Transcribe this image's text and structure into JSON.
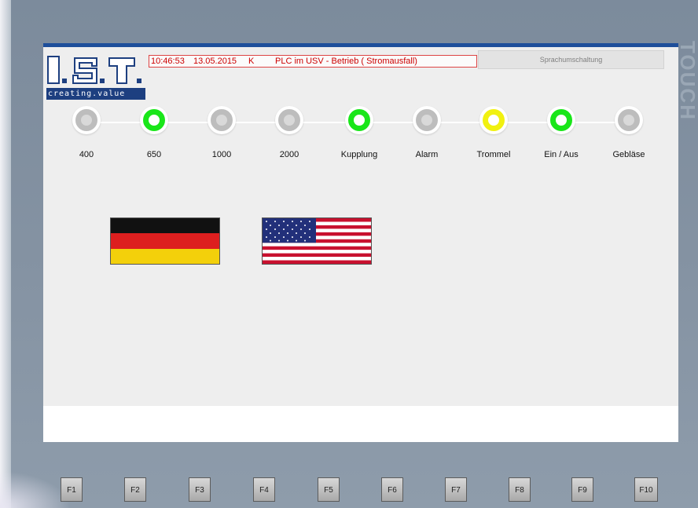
{
  "logo": {
    "name": "I.S.T.",
    "tagline": "creating.value",
    "color": "#1d3f80"
  },
  "status_bar": {
    "time": "10:46:53",
    "date": "13.05.2015",
    "flag": "K",
    "message": "PLC im USV - Betrieb ( Stromausfall)",
    "color": "#cc0000"
  },
  "language_button": {
    "label": "Sprachumschaltung"
  },
  "bezel": {
    "brand_text": "TOUCH"
  },
  "indicators": [
    {
      "label": "400",
      "state": "off"
    },
    {
      "label": "650",
      "state": "green"
    },
    {
      "label": "1000",
      "state": "off"
    },
    {
      "label": "2000",
      "state": "off"
    },
    {
      "label": "Kupplung",
      "state": "green"
    },
    {
      "label": "Alarm",
      "state": "off"
    },
    {
      "label": "Trommel",
      "state": "yellow"
    },
    {
      "label": "Ein / Aus",
      "state": "green"
    },
    {
      "label": "Gebläse",
      "state": "off"
    }
  ],
  "languages": [
    {
      "code": "de",
      "icon": "german-flag-icon"
    },
    {
      "code": "en",
      "icon": "us-flag-icon"
    }
  ],
  "colors": {
    "lamp_green": "#19e619",
    "lamp_yellow": "#f1f110",
    "lamp_off": "#bdbdbd",
    "header_blue": "#1e4e9a"
  },
  "function_keys": [
    "F1",
    "F2",
    "F3",
    "F4",
    "F5",
    "F6",
    "F7",
    "F8",
    "F9",
    "F10"
  ]
}
